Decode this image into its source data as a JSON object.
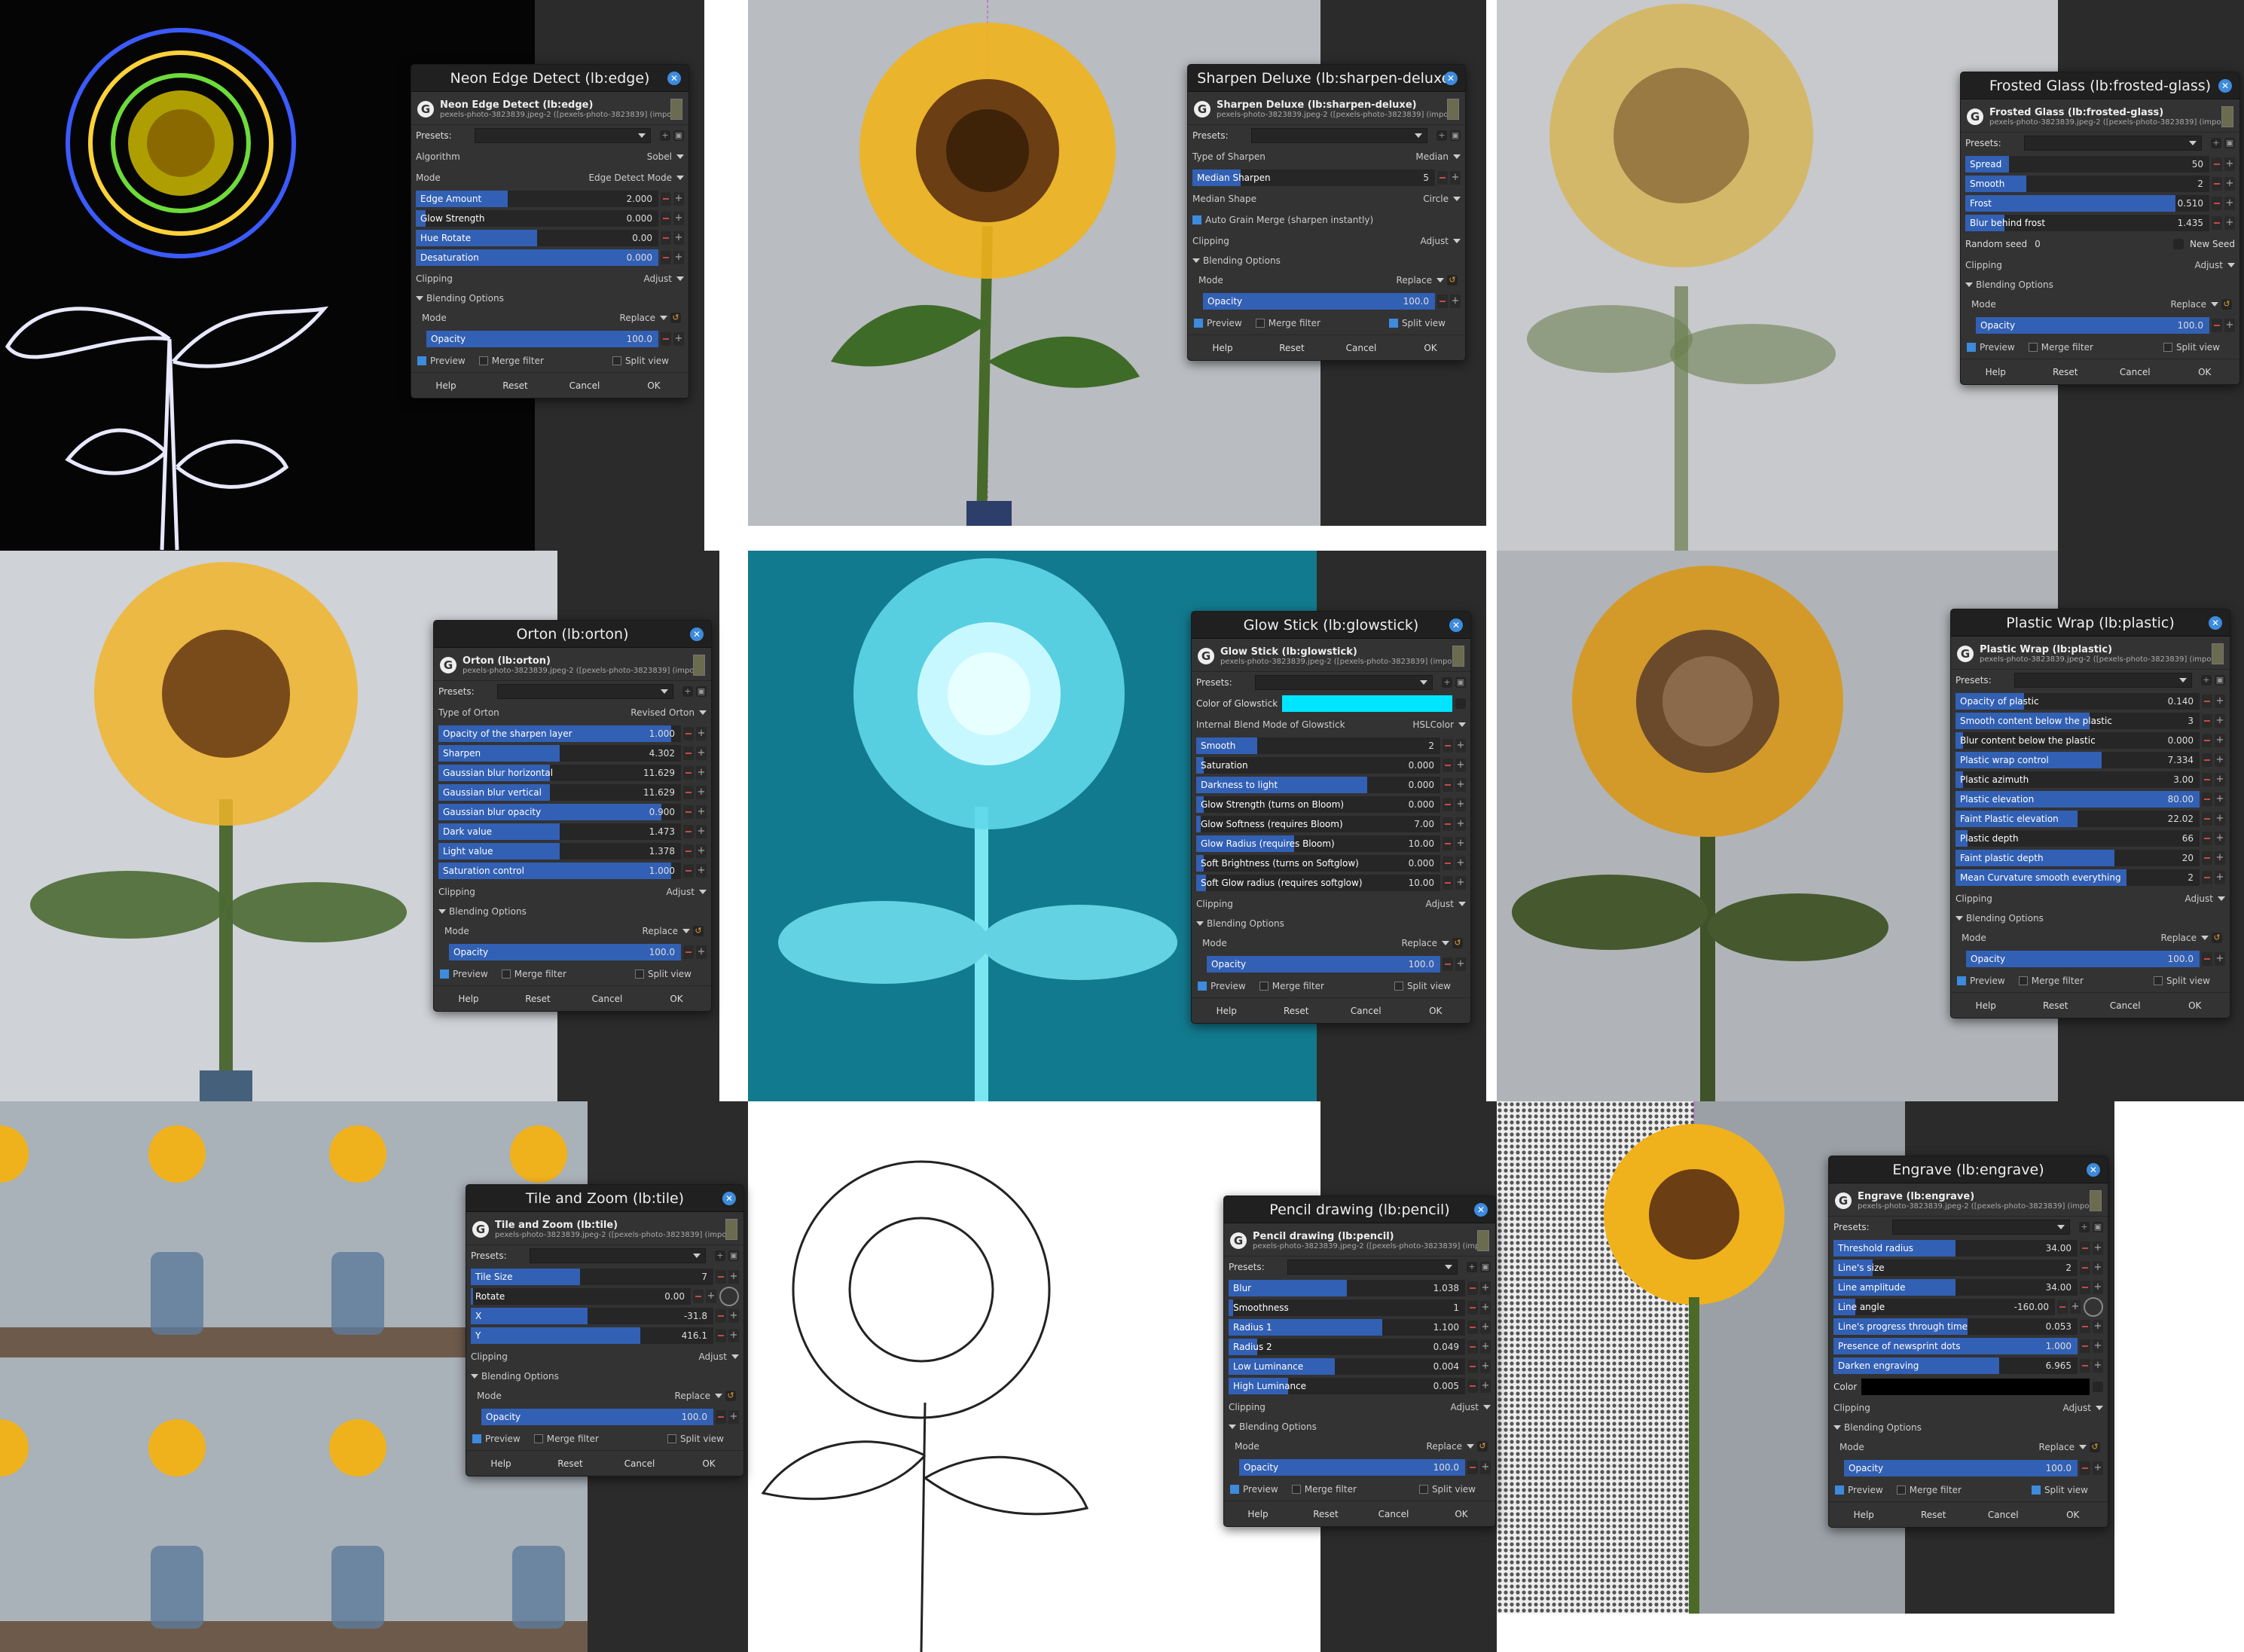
{
  "panels": [
    {
      "key": "edge",
      "title": "Neon Edge Detect (lb:edge)",
      "header": "Neon Edge Detect (lb:edge)",
      "sub": "pexels-photo-3823839.jpeg-2 ([pexels-photo-3823839] (impor...",
      "presets": "Presets:",
      "rows": [
        {
          "t": "select",
          "label": "Algorithm",
          "value": "Sobel"
        },
        {
          "t": "select",
          "label": "Mode",
          "value": "Edge Detect Mode"
        },
        {
          "t": "slider",
          "label": "Edge Amount",
          "value": "2.000",
          "fill": 0.38
        },
        {
          "t": "slider",
          "label": "Glow Strength",
          "value": "0.000",
          "fill": 0.04
        },
        {
          "t": "slider",
          "label": "Hue Rotate",
          "value": "0.00",
          "fill": 0.5
        },
        {
          "t": "slider",
          "label": "Desaturation",
          "value": "0.000",
          "fill": 1.0
        }
      ],
      "clip": "Clipping",
      "clipv": "Adjust",
      "bo": "Blending Options",
      "mode": "Mode",
      "modev": "Replace",
      "op": "Opacity",
      "opv": "100.0",
      "prev": "Preview",
      "merge": "Merge filter",
      "split": "Split view",
      "splitOn": false
    },
    {
      "key": "sharpen",
      "title": "Sharpen Deluxe (lb:sharpen-deluxe)",
      "header": "Sharpen Deluxe (lb:sharpen-deluxe)",
      "sub": "pexels-photo-3823839.jpeg-2 ([pexels-photo-3823839] (impor...",
      "presets": "Presets:",
      "rows": [
        {
          "t": "select",
          "label": "Type of Sharpen",
          "value": "Median"
        },
        {
          "t": "slider",
          "label": "Median Sharpen",
          "value": "5",
          "fill": 0.2
        },
        {
          "t": "select",
          "label": "Median Shape",
          "value": "Circle"
        },
        {
          "t": "check",
          "label": "Auto Grain Merge (sharpen instantly)"
        }
      ],
      "clip": "Clipping",
      "clipv": "Adjust",
      "bo": "Blending Options",
      "mode": "Mode",
      "modev": "Replace",
      "op": "Opacity",
      "opv": "100.0",
      "prev": "Preview",
      "merge": "Merge filter",
      "split": "Split view",
      "splitOn": true
    },
    {
      "key": "frosted",
      "title": "Frosted Glass (lb:frosted-glass)",
      "header": "Frosted Glass (lb:frosted-glass)",
      "sub": "pexels-photo-3823839.jpeg-2 ([pexels-photo-3823839] (impor...",
      "presets": "Presets:",
      "rows": [
        {
          "t": "slider",
          "label": "Spread",
          "value": "50",
          "fill": 0.18
        },
        {
          "t": "slider",
          "label": "Smooth",
          "value": "2",
          "fill": 0.25
        },
        {
          "t": "slider",
          "label": "Frost",
          "value": "0.510",
          "fill": 0.86
        },
        {
          "t": "slider",
          "label": "Blur behind frost",
          "value": "1.435",
          "fill": 0.16
        },
        {
          "t": "seed",
          "label": "Random seed",
          "value": "0",
          "btn": "New Seed"
        }
      ],
      "clip": "Clipping",
      "clipv": "Adjust",
      "bo": "Blending Options",
      "mode": "Mode",
      "modev": "Replace",
      "op": "Opacity",
      "opv": "100.0",
      "prev": "Preview",
      "merge": "Merge filter",
      "split": "Split view",
      "splitOn": false
    },
    {
      "key": "orton",
      "title": "Orton (lb:orton)",
      "header": "Orton (lb:orton)",
      "sub": "pexels-photo-3823839.jpeg-2 ([pexels-photo-3823839] (impor...",
      "presets": "Presets:",
      "rows": [
        {
          "t": "select",
          "label": "Type of Orton",
          "value": "Revised Orton"
        },
        {
          "t": "slider",
          "label": "Opacity of the sharpen layer",
          "value": "1.000",
          "fill": 0.96
        },
        {
          "t": "slider",
          "label": "Sharpen",
          "value": "4.302",
          "fill": 0.5
        },
        {
          "t": "slider",
          "label": "Gaussian blur horizontal",
          "value": "11.629",
          "fill": 0.46
        },
        {
          "t": "slider",
          "label": "Gaussian blur vertical",
          "value": "11.629",
          "fill": 0.46
        },
        {
          "t": "slider",
          "label": "Gaussian blur opacity",
          "value": "0.900",
          "fill": 0.92
        },
        {
          "t": "slider",
          "label": "Dark value",
          "value": "1.473",
          "fill": 0.5
        },
        {
          "t": "slider",
          "label": "Light value",
          "value": "1.378",
          "fill": 0.5
        },
        {
          "t": "slider",
          "label": "Saturation control",
          "value": "1.000",
          "fill": 0.96
        }
      ],
      "clip": "Clipping",
      "clipv": "Adjust",
      "bo": "Blending Options",
      "mode": "Mode",
      "modev": "Replace",
      "op": "Opacity",
      "opv": "100.0",
      "prev": "Preview",
      "merge": "Merge filter",
      "split": "Split view",
      "splitOn": false
    },
    {
      "key": "glow",
      "title": "Glow Stick (lb:glowstick)",
      "header": "Glow Stick (lb:glowstick)",
      "sub": "pexels-photo-3823839.jpeg-2 ([pexels-photo-3823839] (impor...",
      "presets": "Presets:",
      "rows": [
        {
          "t": "color",
          "label": "Color of Glowstick",
          "color": "#00e5ff"
        },
        {
          "t": "select",
          "label": "Internal Blend Mode of Glowstick",
          "value": "HSLColor"
        },
        {
          "t": "slider",
          "label": "Smooth",
          "value": "2",
          "fill": 0.25
        },
        {
          "t": "slider",
          "label": "Saturation",
          "value": "0.000",
          "fill": 0.03
        },
        {
          "t": "slider",
          "label": "Darkness to light",
          "value": "0.000",
          "fill": 0.7
        },
        {
          "t": "slider",
          "label": "Glow Strength (turns on Bloom)",
          "value": "0.000",
          "fill": 0.03
        },
        {
          "t": "slider",
          "label": "Glow Softness (requires Bloom)",
          "value": "7.00",
          "fill": 0.02
        },
        {
          "t": "slider",
          "label": "Glow Radius (requires Bloom)",
          "value": "10.00",
          "fill": 0.4
        },
        {
          "t": "slider",
          "label": "Soft Brightness (turns on Softglow)",
          "value": "0.000",
          "fill": 0.03
        },
        {
          "t": "slider",
          "label": "Soft Glow radius (requires softglow)",
          "value": "10.00",
          "fill": 0.04
        }
      ],
      "clip": "Clipping",
      "clipv": "Adjust",
      "bo": "Blending Options",
      "mode": "Mode",
      "modev": "Replace",
      "op": "Opacity",
      "opv": "100.0",
      "prev": "Preview",
      "merge": "Merge filter",
      "split": "Split view",
      "splitOn": false
    },
    {
      "key": "plastic",
      "title": "Plastic Wrap (lb:plastic)",
      "header": "Plastic Wrap (lb:plastic)",
      "sub": "pexels-photo-3823839.jpeg-2 ([pexels-photo-3823839] (impor...",
      "presets": "Presets:",
      "rows": [
        {
          "t": "slider",
          "label": "Opacity of plastic",
          "value": "0.140",
          "fill": 0.28
        },
        {
          "t": "slider",
          "label": "Smooth content below the plastic",
          "value": "3",
          "fill": 0.55
        },
        {
          "t": "slider",
          "label": "Blur content below the plastic",
          "value": "0.000",
          "fill": 0.03
        },
        {
          "t": "slider",
          "label": "Plastic wrap control",
          "value": "7.334",
          "fill": 0.6
        },
        {
          "t": "slider",
          "label": "Plastic azimuth",
          "value": "3.00",
          "fill": 0.03
        },
        {
          "t": "slider",
          "label": "Plastic elevation",
          "value": "80.00",
          "fill": 1.0
        },
        {
          "t": "slider",
          "label": "Faint Plastic elevation",
          "value": "22.02",
          "fill": 0.5
        },
        {
          "t": "slider",
          "label": "Plastic depth",
          "value": "66",
          "fill": 0.05
        },
        {
          "t": "slider",
          "label": "Faint plastic depth",
          "value": "20",
          "fill": 0.65
        },
        {
          "t": "slider",
          "label": "Mean Curvature smooth everything",
          "value": "2",
          "fill": 0.7
        }
      ],
      "clip": "Clipping",
      "clipv": "Adjust",
      "bo": "Blending Options",
      "mode": "Mode",
      "modev": "Replace",
      "op": "Opacity",
      "opv": "100.0",
      "prev": "Preview",
      "merge": "Merge filter",
      "split": "Split view",
      "splitOn": false
    },
    {
      "key": "tile",
      "title": "Tile and Zoom (lb:tile)",
      "header": "Tile and Zoom (lb:tile)",
      "sub": "pexels-photo-3823839.jpeg-2 ([pexels-photo-3823839] (impor...",
      "presets": "Presets:",
      "rows": [
        {
          "t": "slider",
          "label": "Tile Size",
          "value": "7",
          "fill": 0.45
        },
        {
          "t": "slider",
          "label": "Rotate",
          "value": "0.00",
          "fill": 0.01,
          "spin": true
        },
        {
          "t": "slider",
          "label": "X",
          "value": "-31.8",
          "fill": 0.48
        },
        {
          "t": "slider",
          "label": "Y",
          "value": "416.1",
          "fill": 0.7
        }
      ],
      "clip": "Clipping",
      "clipv": "Adjust",
      "bo": "Blending Options",
      "mode": "Mode",
      "modev": "Replace",
      "op": "Opacity",
      "opv": "100.0",
      "prev": "Preview",
      "merge": "Merge filter",
      "split": "Split view",
      "splitOn": false
    },
    {
      "key": "pencil",
      "title": "Pencil drawing (lb:pencil)",
      "header": "Pencil drawing (lb:pencil)",
      "sub": "pexels-photo-3823839.jpeg-2 ([pexels-photo-3823839] (impor...",
      "presets": "Presets:",
      "rows": [
        {
          "t": "slider",
          "label": "Blur",
          "value": "1.038",
          "fill": 0.5
        },
        {
          "t": "slider",
          "label": "Smoothness",
          "value": "1",
          "fill": 0.02
        },
        {
          "t": "slider",
          "label": "Radius 1",
          "value": "1.100",
          "fill": 0.65
        },
        {
          "t": "slider",
          "label": "Radius 2",
          "value": "0.049",
          "fill": 0.12
        },
        {
          "t": "slider",
          "label": "Low Luminance",
          "value": "0.004",
          "fill": 0.45
        },
        {
          "t": "slider",
          "label": "High Luminance",
          "value": "0.005",
          "fill": 0.25
        }
      ],
      "clip": "Clipping",
      "clipv": "Adjust",
      "bo": "Blending Options",
      "mode": "Mode",
      "modev": "Replace",
      "op": "Opacity",
      "opv": "100.0",
      "prev": "Preview",
      "merge": "Merge filter",
      "split": "Split view",
      "splitOn": false
    },
    {
      "key": "engrave",
      "title": "Engrave (lb:engrave)",
      "header": "Engrave (lb:engrave)",
      "sub": "pexels-photo-3823839.jpeg-2 ([pexels-photo-3823839] (impor...",
      "presets": "Presets:",
      "rows": [
        {
          "t": "slider",
          "label": "Threshold radius",
          "value": "34.00",
          "fill": 0.5
        },
        {
          "t": "slider",
          "label": "Line's size",
          "value": "2",
          "fill": 0.16
        },
        {
          "t": "slider",
          "label": "Line amplitude",
          "value": "34.00",
          "fill": 0.5
        },
        {
          "t": "slider",
          "label": "Line angle",
          "value": "-160.00",
          "fill": 0.1,
          "spin": true
        },
        {
          "t": "slider",
          "label": "Line's progress through time",
          "value": "0.053",
          "fill": 0.55
        },
        {
          "t": "slider",
          "label": "Presence of newsprint dots",
          "value": "1.000",
          "fill": 1.0
        },
        {
          "t": "slider",
          "label": "Darken engraving",
          "value": "6.965",
          "fill": 0.68
        },
        {
          "t": "color",
          "label": "Color",
          "color": "#000000"
        }
      ],
      "clip": "Clipping",
      "clipv": "Adjust",
      "bo": "Blending Options",
      "mode": "Mode",
      "modev": "Replace",
      "op": "Opacity",
      "opv": "100.0",
      "prev": "Preview",
      "merge": "Merge filter",
      "split": "Split view",
      "splitOn": true
    }
  ],
  "buttons": {
    "help": "Help",
    "reset": "Reset",
    "cancel": "Cancel",
    "ok": "OK"
  },
  "icons": {
    "close": "close-icon",
    "logo": "gmic-logo-icon",
    "caret": "chevron-down-icon"
  }
}
